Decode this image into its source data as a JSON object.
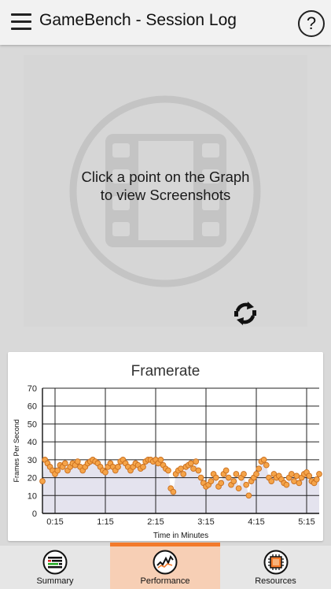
{
  "header": {
    "title": "GameBench - Session Log",
    "help_label": "?"
  },
  "screenshot_panel": {
    "line1": "Click a point on the Graph",
    "line2": "to view Screenshots"
  },
  "chart_card": {
    "title": "Framerate"
  },
  "chart_data": {
    "type": "line",
    "title": "Framerate",
    "xlabel": "Time in Minutes",
    "ylabel": "Frames Per Second",
    "ylim": [
      0,
      70
    ],
    "xlim": [
      0,
      5.5
    ],
    "y_ticks": [
      "0",
      "10",
      "20",
      "30",
      "40",
      "50",
      "60",
      "70"
    ],
    "x_ticks": [
      "0:15",
      "1:15",
      "2:15",
      "3:15",
      "4:15",
      "5:15"
    ],
    "grid": true,
    "series": [
      {
        "color": "#f5a449",
        "x": [
          0.0,
          0.05,
          0.1,
          0.15,
          0.2,
          0.25,
          0.3,
          0.35,
          0.4,
          0.45,
          0.5,
          0.55,
          0.6,
          0.65,
          0.7,
          0.75,
          0.8,
          0.85,
          0.9,
          0.95,
          1.0,
          1.05,
          1.1,
          1.15,
          1.2,
          1.25,
          1.3,
          1.35,
          1.4,
          1.45,
          1.5,
          1.55,
          1.6,
          1.65,
          1.7,
          1.75,
          1.8,
          1.85,
          1.9,
          1.95,
          2.0,
          2.05,
          2.1,
          2.15,
          2.2,
          2.25,
          2.3,
          2.35,
          2.4,
          2.45,
          2.5,
          2.55,
          2.6,
          2.65,
          2.7,
          2.75,
          2.8,
          2.85,
          2.9,
          2.95,
          3.0,
          3.05,
          3.1,
          3.15,
          3.2,
          3.25,
          3.3,
          3.35,
          3.4,
          3.45,
          3.5,
          3.55,
          3.6,
          3.65,
          3.7,
          3.75,
          3.8,
          3.85,
          3.9,
          3.95,
          4.0,
          4.05,
          4.1,
          4.15,
          4.2,
          4.25,
          4.3,
          4.35,
          4.4,
          4.45,
          4.5,
          4.55,
          4.6,
          4.65,
          4.7,
          4.75,
          4.8,
          4.85,
          4.9,
          4.95,
          5.0,
          5.05,
          5.1,
          5.15,
          5.2,
          5.25,
          5.3,
          5.35,
          5.4,
          5.45,
          5.5
        ],
        "y": [
          18,
          30,
          28,
          26,
          24,
          22,
          24,
          27,
          26,
          28,
          24,
          26,
          28,
          27,
          29,
          26,
          24,
          26,
          28,
          29,
          30,
          29,
          28,
          26,
          24,
          23,
          26,
          28,
          26,
          24,
          26,
          29,
          30,
          28,
          26,
          24,
          26,
          28,
          27,
          25,
          26,
          29,
          30,
          30,
          29,
          30,
          28,
          30,
          27,
          25,
          24,
          14,
          12,
          22,
          24,
          25,
          22,
          26,
          27,
          28,
          25,
          29,
          24,
          20,
          17,
          15,
          16,
          18,
          22,
          20,
          15,
          17,
          22,
          24,
          20,
          16,
          18,
          22,
          14,
          20,
          22,
          16,
          10,
          18,
          20,
          22,
          25,
          29,
          30,
          27,
          20,
          18,
          22,
          20,
          21,
          19,
          17,
          16,
          20,
          22,
          18,
          21,
          17,
          20,
          22,
          23,
          21,
          18,
          17,
          19,
          22
        ]
      }
    ]
  },
  "bottom_nav": {
    "tabs": [
      {
        "label": "Summary",
        "icon": "summary-icon"
      },
      {
        "label": "Performance",
        "icon": "performance-icon"
      },
      {
        "label": "Resources",
        "icon": "resources-icon"
      }
    ],
    "active_index": 1
  },
  "colors": {
    "accent": "#f37a2b",
    "active_tab_bg": "#f7cfb5",
    "chart_fill": "#e4e3ee",
    "point": "#f5a449",
    "point_stroke": "#c96e1d"
  }
}
